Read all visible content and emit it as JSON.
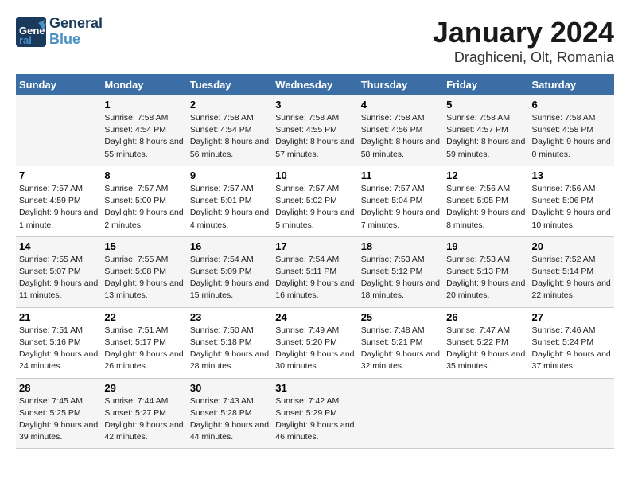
{
  "logo": {
    "text1": "General",
    "text2": "Blue"
  },
  "title": "January 2024",
  "subtitle": "Draghiceni, Olt, Romania",
  "days_of_week": [
    "Sunday",
    "Monday",
    "Tuesday",
    "Wednesday",
    "Thursday",
    "Friday",
    "Saturday"
  ],
  "weeks": [
    [
      {
        "date": "",
        "sunrise": "",
        "sunset": "",
        "daylight": ""
      },
      {
        "date": "1",
        "sunrise": "Sunrise: 7:58 AM",
        "sunset": "Sunset: 4:54 PM",
        "daylight": "Daylight: 8 hours and 55 minutes."
      },
      {
        "date": "2",
        "sunrise": "Sunrise: 7:58 AM",
        "sunset": "Sunset: 4:54 PM",
        "daylight": "Daylight: 8 hours and 56 minutes."
      },
      {
        "date": "3",
        "sunrise": "Sunrise: 7:58 AM",
        "sunset": "Sunset: 4:55 PM",
        "daylight": "Daylight: 8 hours and 57 minutes."
      },
      {
        "date": "4",
        "sunrise": "Sunrise: 7:58 AM",
        "sunset": "Sunset: 4:56 PM",
        "daylight": "Daylight: 8 hours and 58 minutes."
      },
      {
        "date": "5",
        "sunrise": "Sunrise: 7:58 AM",
        "sunset": "Sunset: 4:57 PM",
        "daylight": "Daylight: 8 hours and 59 minutes."
      },
      {
        "date": "6",
        "sunrise": "Sunrise: 7:58 AM",
        "sunset": "Sunset: 4:58 PM",
        "daylight": "Daylight: 9 hours and 0 minutes."
      }
    ],
    [
      {
        "date": "7",
        "sunrise": "Sunrise: 7:57 AM",
        "sunset": "Sunset: 4:59 PM",
        "daylight": "Daylight: 9 hours and 1 minute."
      },
      {
        "date": "8",
        "sunrise": "Sunrise: 7:57 AM",
        "sunset": "Sunset: 5:00 PM",
        "daylight": "Daylight: 9 hours and 2 minutes."
      },
      {
        "date": "9",
        "sunrise": "Sunrise: 7:57 AM",
        "sunset": "Sunset: 5:01 PM",
        "daylight": "Daylight: 9 hours and 4 minutes."
      },
      {
        "date": "10",
        "sunrise": "Sunrise: 7:57 AM",
        "sunset": "Sunset: 5:02 PM",
        "daylight": "Daylight: 9 hours and 5 minutes."
      },
      {
        "date": "11",
        "sunrise": "Sunrise: 7:57 AM",
        "sunset": "Sunset: 5:04 PM",
        "daylight": "Daylight: 9 hours and 7 minutes."
      },
      {
        "date": "12",
        "sunrise": "Sunrise: 7:56 AM",
        "sunset": "Sunset: 5:05 PM",
        "daylight": "Daylight: 9 hours and 8 minutes."
      },
      {
        "date": "13",
        "sunrise": "Sunrise: 7:56 AM",
        "sunset": "Sunset: 5:06 PM",
        "daylight": "Daylight: 9 hours and 10 minutes."
      }
    ],
    [
      {
        "date": "14",
        "sunrise": "Sunrise: 7:55 AM",
        "sunset": "Sunset: 5:07 PM",
        "daylight": "Daylight: 9 hours and 11 minutes."
      },
      {
        "date": "15",
        "sunrise": "Sunrise: 7:55 AM",
        "sunset": "Sunset: 5:08 PM",
        "daylight": "Daylight: 9 hours and 13 minutes."
      },
      {
        "date": "16",
        "sunrise": "Sunrise: 7:54 AM",
        "sunset": "Sunset: 5:09 PM",
        "daylight": "Daylight: 9 hours and 15 minutes."
      },
      {
        "date": "17",
        "sunrise": "Sunrise: 7:54 AM",
        "sunset": "Sunset: 5:11 PM",
        "daylight": "Daylight: 9 hours and 16 minutes."
      },
      {
        "date": "18",
        "sunrise": "Sunrise: 7:53 AM",
        "sunset": "Sunset: 5:12 PM",
        "daylight": "Daylight: 9 hours and 18 minutes."
      },
      {
        "date": "19",
        "sunrise": "Sunrise: 7:53 AM",
        "sunset": "Sunset: 5:13 PM",
        "daylight": "Daylight: 9 hours and 20 minutes."
      },
      {
        "date": "20",
        "sunrise": "Sunrise: 7:52 AM",
        "sunset": "Sunset: 5:14 PM",
        "daylight": "Daylight: 9 hours and 22 minutes."
      }
    ],
    [
      {
        "date": "21",
        "sunrise": "Sunrise: 7:51 AM",
        "sunset": "Sunset: 5:16 PM",
        "daylight": "Daylight: 9 hours and 24 minutes."
      },
      {
        "date": "22",
        "sunrise": "Sunrise: 7:51 AM",
        "sunset": "Sunset: 5:17 PM",
        "daylight": "Daylight: 9 hours and 26 minutes."
      },
      {
        "date": "23",
        "sunrise": "Sunrise: 7:50 AM",
        "sunset": "Sunset: 5:18 PM",
        "daylight": "Daylight: 9 hours and 28 minutes."
      },
      {
        "date": "24",
        "sunrise": "Sunrise: 7:49 AM",
        "sunset": "Sunset: 5:20 PM",
        "daylight": "Daylight: 9 hours and 30 minutes."
      },
      {
        "date": "25",
        "sunrise": "Sunrise: 7:48 AM",
        "sunset": "Sunset: 5:21 PM",
        "daylight": "Daylight: 9 hours and 32 minutes."
      },
      {
        "date": "26",
        "sunrise": "Sunrise: 7:47 AM",
        "sunset": "Sunset: 5:22 PM",
        "daylight": "Daylight: 9 hours and 35 minutes."
      },
      {
        "date": "27",
        "sunrise": "Sunrise: 7:46 AM",
        "sunset": "Sunset: 5:24 PM",
        "daylight": "Daylight: 9 hours and 37 minutes."
      }
    ],
    [
      {
        "date": "28",
        "sunrise": "Sunrise: 7:45 AM",
        "sunset": "Sunset: 5:25 PM",
        "daylight": "Daylight: 9 hours and 39 minutes."
      },
      {
        "date": "29",
        "sunrise": "Sunrise: 7:44 AM",
        "sunset": "Sunset: 5:27 PM",
        "daylight": "Daylight: 9 hours and 42 minutes."
      },
      {
        "date": "30",
        "sunrise": "Sunrise: 7:43 AM",
        "sunset": "Sunset: 5:28 PM",
        "daylight": "Daylight: 9 hours and 44 minutes."
      },
      {
        "date": "31",
        "sunrise": "Sunrise: 7:42 AM",
        "sunset": "Sunset: 5:29 PM",
        "daylight": "Daylight: 9 hours and 46 minutes."
      },
      {
        "date": "",
        "sunrise": "",
        "sunset": "",
        "daylight": ""
      },
      {
        "date": "",
        "sunrise": "",
        "sunset": "",
        "daylight": ""
      },
      {
        "date": "",
        "sunrise": "",
        "sunset": "",
        "daylight": ""
      }
    ]
  ]
}
